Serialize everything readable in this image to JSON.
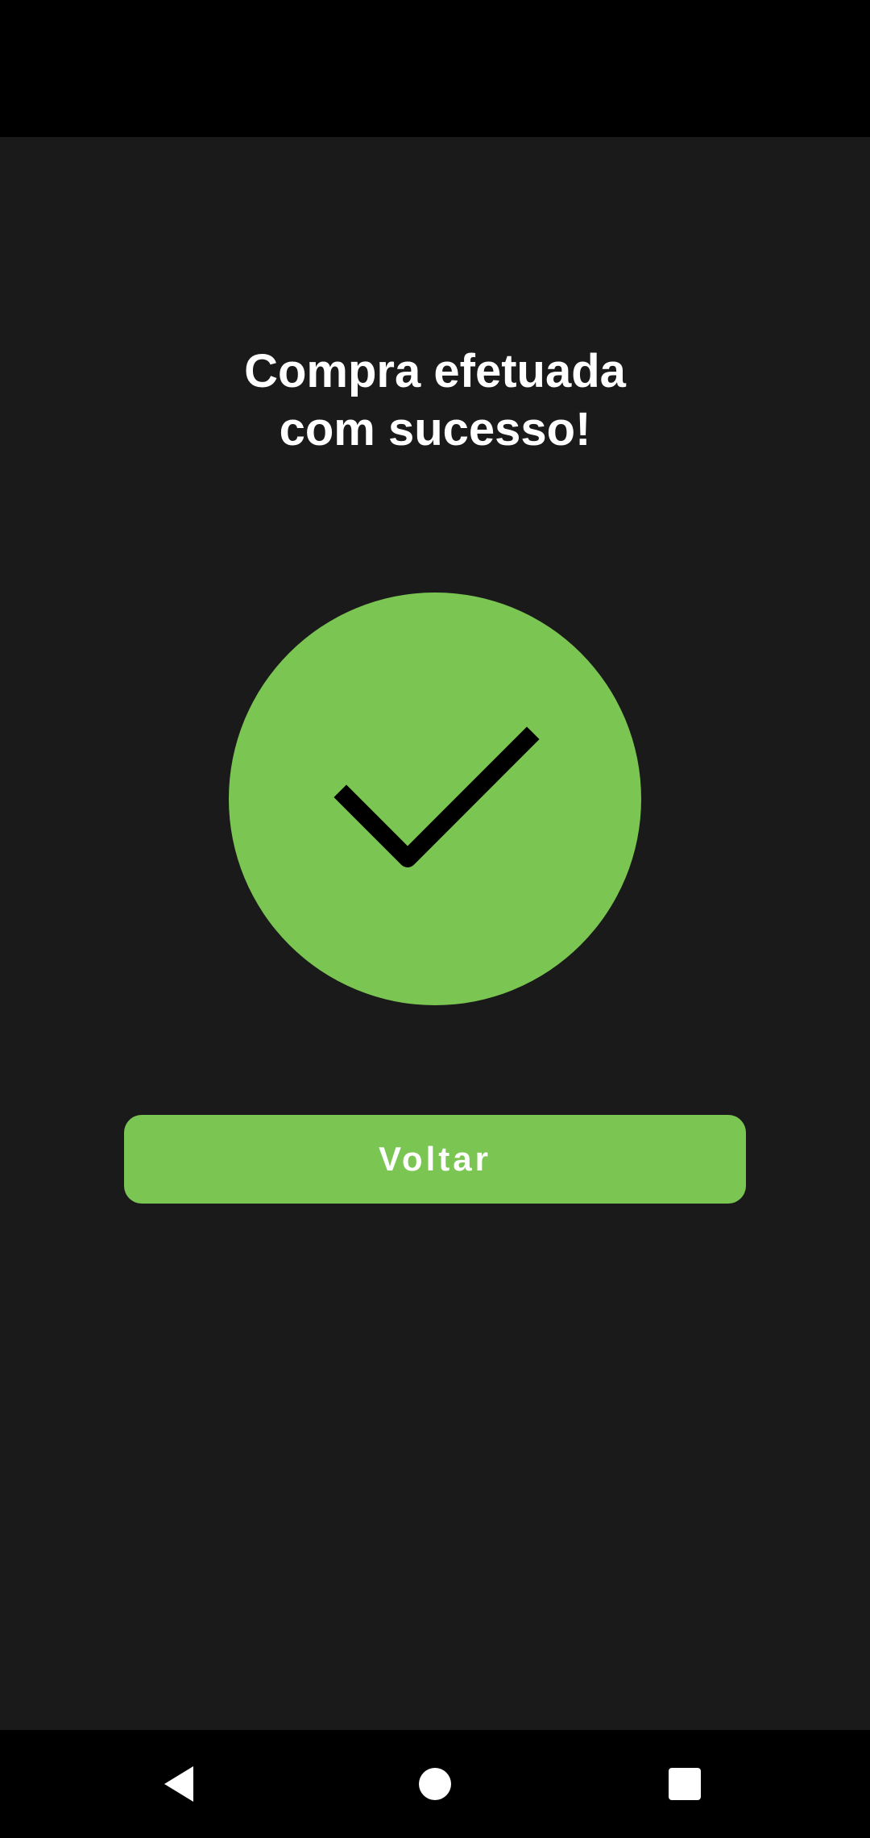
{
  "title": {
    "line1": "Compra efetuada",
    "line2": "com sucesso!"
  },
  "success_icon": {
    "icon": "checkmark-icon",
    "color": "#7bc652"
  },
  "back_button": {
    "label": "Voltar",
    "color": "#7bc652"
  },
  "navigation": {
    "back": "nav-back-icon",
    "home": "nav-home-icon",
    "recents": "nav-recents-icon"
  },
  "colors": {
    "background": "#1a1a1a",
    "accent": "#7bc652",
    "text": "#ffffff"
  }
}
